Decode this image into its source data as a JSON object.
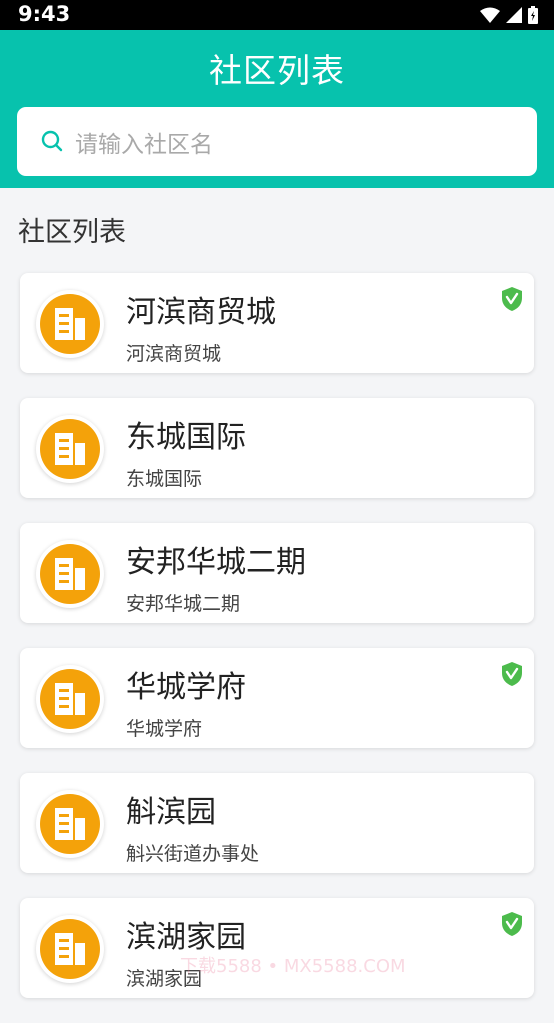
{
  "status_bar": {
    "time": "9:43",
    "icons": [
      "wifi-icon",
      "cellular-icon",
      "battery-icon"
    ]
  },
  "header": {
    "title": "社区列表"
  },
  "search": {
    "placeholder": "请输入社区名",
    "icon": "search-icon"
  },
  "section": {
    "title": "社区列表"
  },
  "communities": [
    {
      "name": "河滨商贸城",
      "subtitle": "河滨商贸城",
      "verified": true
    },
    {
      "name": "东城国际",
      "subtitle": "东城国际",
      "verified": false
    },
    {
      "name": "安邦华城二期",
      "subtitle": "安邦华城二期",
      "verified": false
    },
    {
      "name": "华城学府",
      "subtitle": "华城学府",
      "verified": true
    },
    {
      "name": "斛滨园",
      "subtitle": "斛兴街道办事处",
      "verified": false
    },
    {
      "name": "滨湖家园",
      "subtitle": "滨湖家园",
      "verified": true
    }
  ],
  "watermark": "下载5588 • MX5588.COM",
  "colors": {
    "primary": "#07c2ad",
    "avatar": "#f4a20a",
    "verified": "#4cbb4c"
  }
}
